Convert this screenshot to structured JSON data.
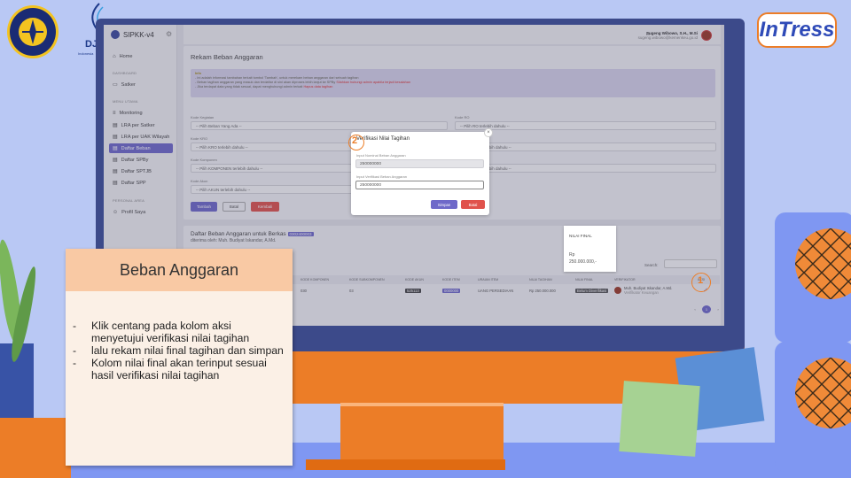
{
  "branding": {
    "dj_text": "DJ",
    "dj_subtitle": "Indonesia",
    "intress_logo": "InTress"
  },
  "app": {
    "name": "SIPKK-v4",
    "user_name": "Sugeng Wibowo, S.H., M.Si",
    "user_email": "sugeng.wibowo@kemenkeu.go.id"
  },
  "sidebar": {
    "home": "Home",
    "section_dashboard": "DASHBOARD",
    "dashboard": "Satker",
    "section_menu": "MENU UTAMA",
    "items": [
      {
        "label": "Monitoring",
        "icon": "list-icon"
      },
      {
        "label": "LRA per Satker",
        "icon": "doc-icon"
      },
      {
        "label": "LRA per UAK Wilayah",
        "icon": "doc-icon"
      },
      {
        "label": "Daftar Beban",
        "icon": "doc-icon"
      },
      {
        "label": "Daftar SPBy",
        "icon": "doc-icon"
      },
      {
        "label": "Daftar SPTJB",
        "icon": "doc-icon"
      },
      {
        "label": "Daftar SPP",
        "icon": "doc-icon"
      }
    ],
    "section_personal": "PERSONAL AREA",
    "profile": "Profil Saya"
  },
  "form": {
    "page_title": "Rekam Beban Anggaran",
    "alert_title": "Info",
    "alert_line1": "- Ini adalah informasi tambahan terkait tombol 'Tambah', untuk merekam beban anggaran dari sebuah tagihan",
    "alert_line2": "- Beban tagihan anggaran yang masuk dan terdaftar di sini akan diproses lebih lanjut ke SPBy",
    "alert_line3_warn": "Silahkan hubungi admin apabila terjadi kesalahan",
    "alert_line4": "- Jika terdapat data yang tidak sesuai, dapat menghubungi admin terkait",
    "alert_line4_red": "Hapus data tagihan",
    "label_kegiatan": "Kode Kegiatan",
    "input_kegiatan": "-- Pilih Beban Yang Ada --",
    "label_kro": "Kode KRO",
    "input_kro": "-- Pilih KRO terlebih dahulu --",
    "label_komponen": "Kode Komponen",
    "input_komponen": "-- Pilih KOMPONEN terlebih dahulu --",
    "label_akun": "Kode Akun",
    "input_akun": "-- Pilih AKUN terlebih dahulu --",
    "label_ro": "Kode RO",
    "input_ro": "-- Pilih RO terlebih dahulu --",
    "input_right2": "-- Pilih data terlebih dahulu --",
    "input_right3": "-- Pilih data terlebih dahulu --",
    "btn_tambah": "Tambah",
    "btn_batal": "Batal",
    "btn_kembali": "Kembali"
  },
  "list": {
    "title": "Daftar Beban Anggaran untuk Berkas",
    "berkas_tag": "0302400003",
    "submitted_by": "diterima oleh: Muh. Budiyat Iskandar, A.Md.",
    "search_label": "Search:",
    "columns": [
      "KODE KOMPONEN",
      "KODE SUBKOMPONEN",
      "KODE AKUN",
      "KODE ITEM",
      "URAIAN ITEM",
      "NILAI TAGIHAN",
      "NILAI FINAL",
      "VERIFIKATOR",
      "AKSI"
    ],
    "row": {
      "komponen": "030",
      "subkomponen": "03",
      "akun": "525113",
      "item": "0000000",
      "uraian": "UANG PERSEDIAAN",
      "nilai_tagihan": "Rp 250.000.000",
      "nilai_final": "Belum Diverifikasi",
      "verifikator": "Muh. Budiyat Iskandar, A.Md.",
      "verifikator_sub": "Verifikator Keuangan"
    },
    "page": "1"
  },
  "modal": {
    "title": "Verifikasi Nilai Tagihan",
    "label_tagihan": "Input Nominal Beban Anggaran",
    "value_tagihan": "250000000",
    "label_final": "Input Verifikasi Beban Anggaran",
    "value_final": "250000000",
    "btn_simpan": "Simpan",
    "btn_batal": "Batal",
    "step": "2"
  },
  "popup": {
    "header": "NILAI FINAL",
    "value_line1": "Rp",
    "value_line2": "250.000.000,-"
  },
  "step_marker": "1",
  "note": {
    "title": "Beban Anggaran",
    "items": [
      "Klik centang pada kolom aksi menyetujui verifikasi nilai tagihan",
      "lalu rekam nilai final tagihan dan simpan",
      "Kolom nilai final akan terinput sesuai hasil verifikasi nilai tagihan"
    ]
  },
  "colors": {
    "accent": "#6e69c9",
    "orange": "#ec7d27",
    "danger": "#e0524c",
    "background": "#b9c8f4"
  }
}
